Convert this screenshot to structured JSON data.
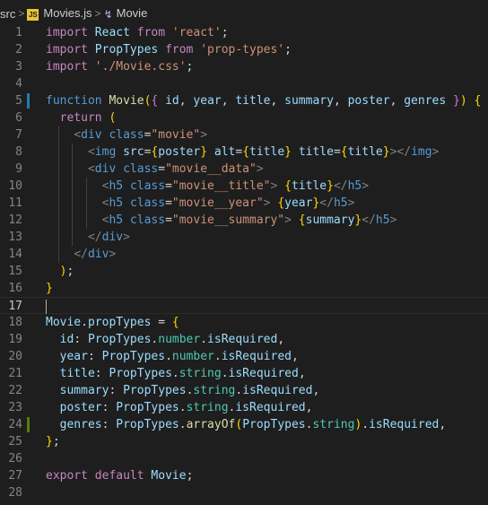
{
  "breadcrumb": {
    "folder": "src",
    "file": "Movies.js",
    "file_icon": "JS",
    "symbol_icon": "component-icon",
    "symbol": "Movie"
  },
  "colors": {
    "background": "#1e1e1e",
    "line_number": "#858585",
    "git_modified": "#1b81a8",
    "git_added": "#587c0c"
  },
  "editor": {
    "active_line": 17,
    "lines": [
      {
        "n": 1,
        "text": "import React from 'react';"
      },
      {
        "n": 2,
        "text": "import PropTypes from 'prop-types';"
      },
      {
        "n": 3,
        "text": "import './Movie.css';"
      },
      {
        "n": 4,
        "text": ""
      },
      {
        "n": 5,
        "text": "function Movie({ id, year, title, summary, poster, genres }) {"
      },
      {
        "n": 6,
        "text": "  return ("
      },
      {
        "n": 7,
        "text": "    <div class=\"movie\">"
      },
      {
        "n": 8,
        "text": "      <img src={poster} alt={title} title={title}></img>"
      },
      {
        "n": 9,
        "text": "      <div class=\"movie__data\">"
      },
      {
        "n": 10,
        "text": "        <h5 class=\"movie__title\"> {title}</h5>"
      },
      {
        "n": 11,
        "text": "        <h5 class=\"movie__year\"> {year}</h5>"
      },
      {
        "n": 12,
        "text": "        <h5 class=\"movie__summary\"> {summary}</h5>"
      },
      {
        "n": 13,
        "text": "      </div>"
      },
      {
        "n": 14,
        "text": "    </div>"
      },
      {
        "n": 15,
        "text": "  );"
      },
      {
        "n": 16,
        "text": "}"
      },
      {
        "n": 17,
        "text": ""
      },
      {
        "n": 18,
        "text": "Movie.propTypes = {"
      },
      {
        "n": 19,
        "text": "  id: PropTypes.number.isRequired,"
      },
      {
        "n": 20,
        "text": "  year: PropTypes.number.isRequired,"
      },
      {
        "n": 21,
        "text": "  title: PropTypes.string.isRequired,"
      },
      {
        "n": 22,
        "text": "  summary: PropTypes.string.isRequired,"
      },
      {
        "n": 23,
        "text": "  poster: PropTypes.string.isRequired,"
      },
      {
        "n": 24,
        "text": "  genres: PropTypes.arrayOf(PropTypes.string).isRequired,"
      },
      {
        "n": 25,
        "text": "};"
      },
      {
        "n": 26,
        "text": ""
      },
      {
        "n": 27,
        "text": "export default Movie;"
      },
      {
        "n": 28,
        "text": ""
      }
    ]
  }
}
